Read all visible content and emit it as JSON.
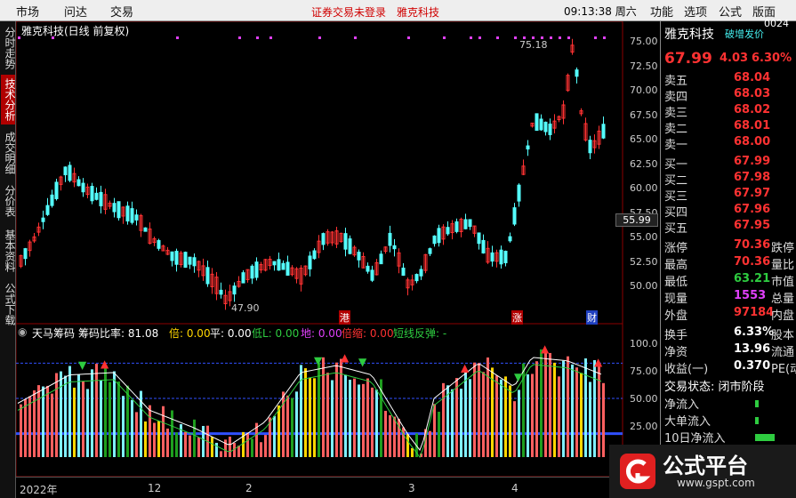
{
  "topbar": {
    "menu1": "市场",
    "menu2": "问达",
    "menu3": "交易",
    "status": "证券交易未登录　雅克科技",
    "time": "09:13:38 周六",
    "menu4": "功能",
    "menu5": "选项",
    "menu6": "公式",
    "menu7": "版面"
  },
  "leftbar": {
    "tab1": "分时走势",
    "tab2": "技术分析",
    "tab3": "成交明细",
    "tab4": "分价表",
    "tab5": "基本资料",
    "tab6": "公式下载"
  },
  "main": {
    "title": "雅克科技(日线 前复权)",
    "high_label": "75.18",
    "low_label": "47.90",
    "current_price": "55.99",
    "price_ticks": [
      "75.00",
      "72.50",
      "70.00",
      "67.50",
      "65.00",
      "62.50",
      "60.00",
      "57.50",
      "55.00",
      "52.50",
      "50.00"
    ],
    "markers": {
      "m1": "港",
      "m2": "涨",
      "m3": "财"
    }
  },
  "indicator": {
    "name": "天马筹码",
    "ratio": "筹码比率: 81.08",
    "b1": "倍: 0.00",
    "b2": "平: 0.00",
    "b3": "低L: 0.00",
    "b4": "地: 0.00",
    "b5": "倍缩: 0.00",
    "b6": "短线反弹: -",
    "ticks": [
      "100.0",
      "75.00",
      "50.00",
      "25.00"
    ]
  },
  "timeline": {
    "t1": "2022年",
    "t2": "12",
    "t3": "2",
    "t4": "3",
    "t5": "4"
  },
  "rightpanel": {
    "name": "雅克科技",
    "code": "0024",
    "tag": "破增发价",
    "price": "67.99",
    "change": "4.03",
    "pct": "6.30%",
    "asks": [
      {
        "l": "卖五",
        "v": "68.04"
      },
      {
        "l": "卖四",
        "v": "68.03"
      },
      {
        "l": "卖三",
        "v": "68.02"
      },
      {
        "l": "卖二",
        "v": "68.01"
      },
      {
        "l": "卖一",
        "v": "68.00"
      }
    ],
    "bids": [
      {
        "l": "买一",
        "v": "67.99"
      },
      {
        "l": "买二",
        "v": "67.98"
      },
      {
        "l": "买三",
        "v": "67.97"
      },
      {
        "l": "买四",
        "v": "67.96"
      },
      {
        "l": "买五",
        "v": "67.95"
      }
    ],
    "stats": [
      {
        "l": "涨停",
        "v": "70.36",
        "r": "跌停"
      },
      {
        "l": "最高",
        "v": "70.36",
        "r": "量比"
      },
      {
        "l": "最低",
        "v": "63.21",
        "r": "市值"
      },
      {
        "l": "现量",
        "v": "1553",
        "r": "总量"
      },
      {
        "l": "外盘",
        "v": "97184",
        "r": "内盘"
      }
    ],
    "stats2": [
      {
        "l": "换手",
        "v": "6.33%",
        "r": "股本"
      },
      {
        "l": "净资",
        "v": "13.96",
        "r": "流通"
      },
      {
        "l": "收益(一)",
        "v": "0.370",
        "r": "PE(动"
      }
    ],
    "state": "交易状态: 闭市阶段",
    "flows": [
      {
        "l": "净流入"
      },
      {
        "l": "大单流入"
      },
      {
        "l": "10日净流入"
      }
    ]
  },
  "logo": {
    "text": "公式平台",
    "url": "www.gspt.com"
  },
  "colors": {
    "up": "#ff3232",
    "down": "#54ffff",
    "bg": "#000000"
  }
}
